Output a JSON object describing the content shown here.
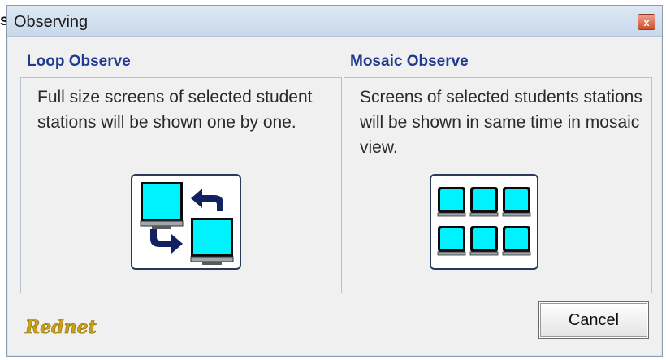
{
  "edge_fragment": "s",
  "dialog": {
    "title": "Observing",
    "close_symbol": "x"
  },
  "loop_observe": {
    "heading": "Loop Observe",
    "description": "Full size screens of selected student stations will be shown one by one.",
    "icon": "loop-observe-icon"
  },
  "mosaic_observe": {
    "heading": "Mosaic Observe",
    "description": "Screens of selected students stations will be shown in same time in mosaic view.",
    "icon": "mosaic-observe-icon"
  },
  "logo": {
    "text": "Rednet",
    "color": "#c9a21a"
  },
  "buttons": {
    "cancel": "Cancel"
  },
  "colors": {
    "heading": "#1f3a93",
    "screen": "#00f2ff",
    "arrow": "#12215f"
  }
}
